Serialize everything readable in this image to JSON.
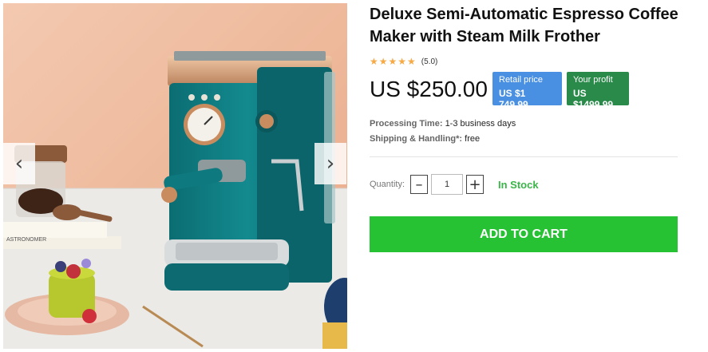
{
  "product": {
    "title": "Deluxe Semi-Automatic Espresso Coffee Maker with Steam Milk Frother",
    "stars": "★★★★★",
    "rating": "(5.0)",
    "price": "US $250.00",
    "retail": {
      "label": "Retail price",
      "value": "US $1 749.99",
      "color": "#4a90e2"
    },
    "profit": {
      "label": "Your profit",
      "value": "US $1499.99",
      "color": "#2a8a4a"
    },
    "processing_label": "Processing Time:",
    "processing_value": "1-3 business days",
    "shipping_label": "Shipping & Handling*:",
    "shipping_value": "free"
  },
  "gallery": {
    "prev_icon": "‹",
    "next_icon": "›",
    "book_text": "ASTRONOMER"
  },
  "purchase": {
    "quantity_label": "Quantity:",
    "minus": "–",
    "plus": "+",
    "quantity_value": "1",
    "stock": "In Stock",
    "stock_color": "#3bb54a",
    "add_to_cart": "ADD TO CART",
    "cart_color": "#27c234"
  }
}
